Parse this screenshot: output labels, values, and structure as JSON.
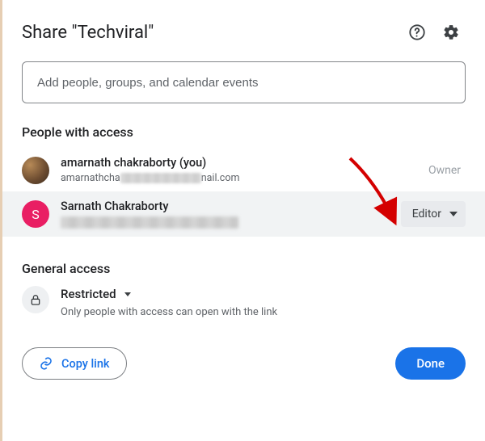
{
  "header": {
    "title": "Share \"Techviral\"",
    "help_icon": "help-icon",
    "settings_icon": "gear-icon"
  },
  "input": {
    "placeholder": "Add people, groups, and calendar events"
  },
  "people_section": {
    "title": "People with access",
    "items": [
      {
        "name": "amarnath chakraborty (you)",
        "email_prefix": "amarnathcha",
        "email_suffix": "nail.com",
        "role": "Owner",
        "avatar_type": "photo"
      },
      {
        "name": "Sarnath Chakraborty",
        "role": "Editor",
        "avatar_type": "letter",
        "avatar_letter": "S"
      }
    ]
  },
  "general_access": {
    "title": "General access",
    "mode": "Restricted",
    "description": "Only people with access can open with the link"
  },
  "footer": {
    "copy_link": "Copy link",
    "done": "Done"
  }
}
